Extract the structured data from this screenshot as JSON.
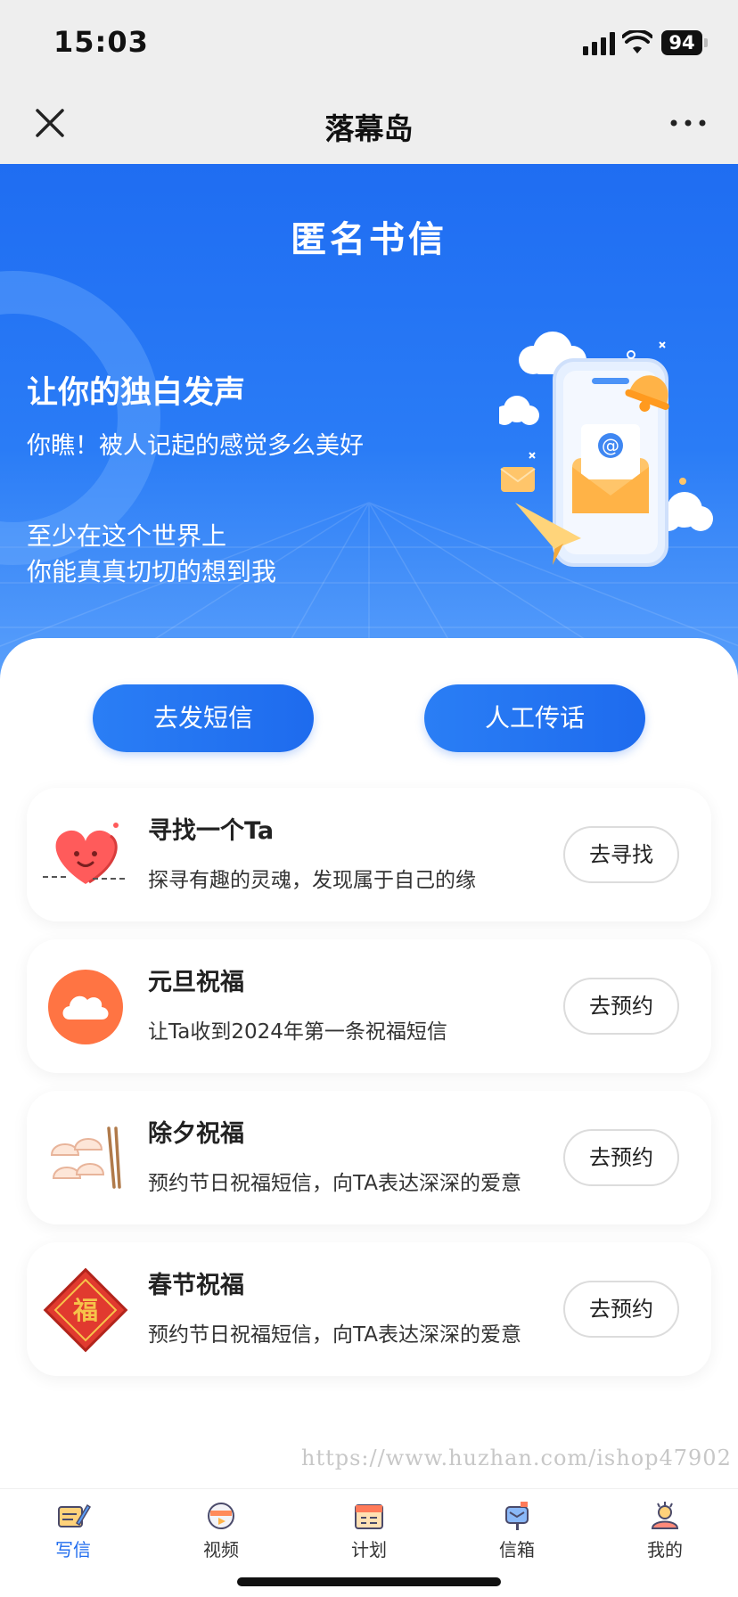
{
  "status_bar": {
    "time": "15:03",
    "battery": "94"
  },
  "nav": {
    "title": "落幕岛",
    "close_icon": "close-icon",
    "more_icon": "more-icon"
  },
  "hero": {
    "title": "匿名书信",
    "heading": "让你的独白发声",
    "subheading": "你瞧！被人记起的感觉多么美好",
    "line1": "至少在这个世界上",
    "line2": "你能真真切切的想到我"
  },
  "actions": {
    "send_sms": "去发短信",
    "manual_message": "人工传话"
  },
  "cards": [
    {
      "title": "寻找一个Ta",
      "desc": "探寻有趣的灵魂，发现属于自己的缘",
      "button": "去寻找",
      "icon": "heart-icon"
    },
    {
      "title": "元旦祝福",
      "desc": "让Ta收到2024年第一条祝福短信",
      "button": "去预约",
      "icon": "cloud-icon"
    },
    {
      "title": "除夕祝福",
      "desc": "预约节日祝福短信，向TA表达深深的爱意",
      "button": "去预约",
      "icon": "dumplings-icon"
    },
    {
      "title": "春节祝福",
      "desc": "预约节日祝福短信，向TA表达深深的爱意",
      "button": "去预约",
      "icon": "fu-icon"
    }
  ],
  "watermark": "https://www.huzhan.com/ishop47902",
  "tabs": [
    {
      "label": "写信",
      "icon": "write-letter-icon",
      "active": true
    },
    {
      "label": "视频",
      "icon": "video-icon",
      "active": false
    },
    {
      "label": "计划",
      "icon": "calendar-icon",
      "active": false
    },
    {
      "label": "信箱",
      "icon": "mailbox-icon",
      "active": false
    },
    {
      "label": "我的",
      "icon": "profile-icon",
      "active": false
    }
  ],
  "colors": {
    "primary": "#1e6bee",
    "hero_top": "#1f6df2",
    "hero_bottom": "#5aa0fb",
    "cloud_orange": "#ff7443"
  }
}
